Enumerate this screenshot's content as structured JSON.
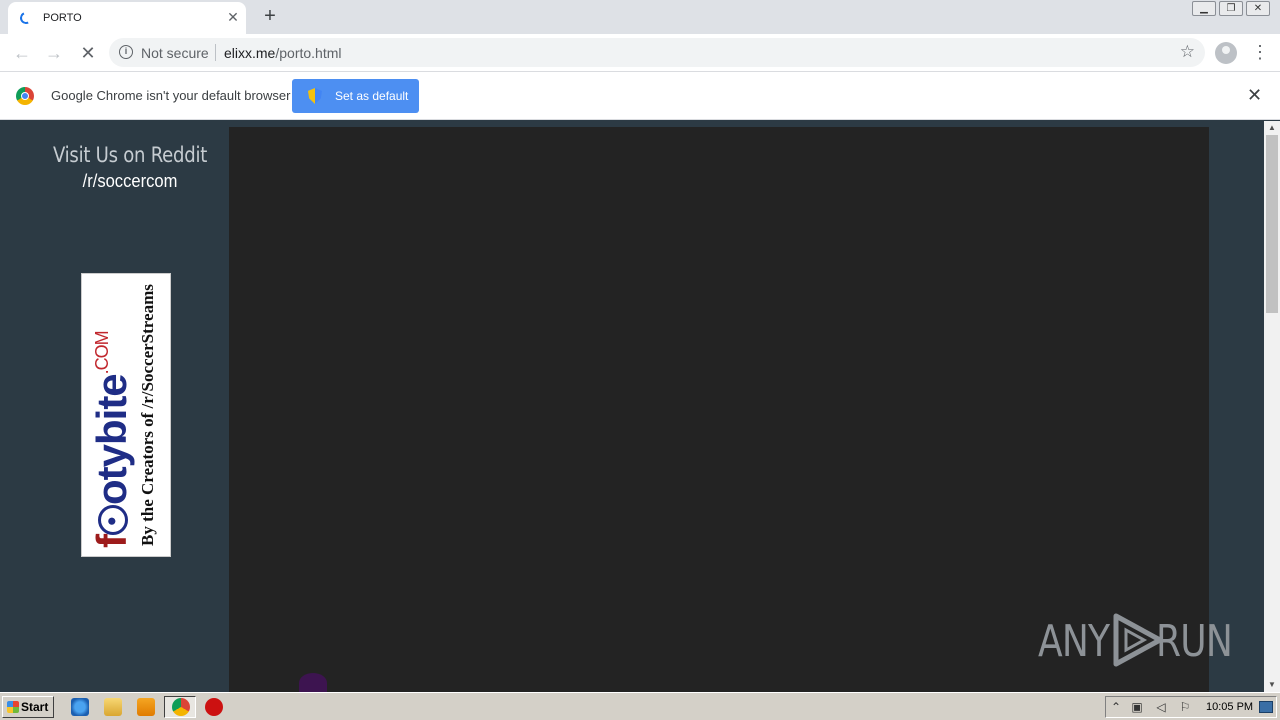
{
  "browser": {
    "tab": {
      "title": "PORTO"
    },
    "toolbar": {
      "security_label": "Not secure",
      "url_host": "elixx.me",
      "url_path": "/porto.html"
    },
    "infobar": {
      "message": "Google Chrome isn't your default browser",
      "button_label": "Set as default"
    }
  },
  "page": {
    "reddit_heading": "Visit Us on Reddit",
    "reddit_subreddit": "/r/soccercom",
    "ad": {
      "brand_prefix": "f",
      "brand_blue": "otybite",
      "brand_suffix": ".COM",
      "tagline": "By the Creators of /r/SoccerStreams"
    }
  },
  "watermark": {
    "left": "ANY",
    "right": "RUN"
  },
  "taskbar": {
    "start_label": "Start",
    "clock": "10:05 PM"
  },
  "colors": {
    "page_bg": "#2c3a44",
    "player_bg": "#232323",
    "infobar_button": "#4d8ff2",
    "ad_brand_red": "#9d1b1b",
    "ad_brand_blue": "#1f2d86"
  }
}
